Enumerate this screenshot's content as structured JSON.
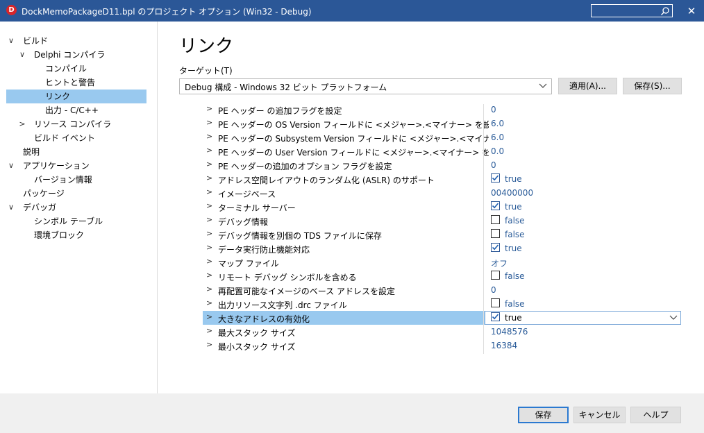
{
  "window": {
    "title": "DockMemoPackageD11.bpl のプロジェクト オプション  (Win32 - Debug)",
    "app_icon": "delphi-icon",
    "search_value": "",
    "close_glyph": "✕"
  },
  "sidebar": {
    "items": [
      {
        "label": "ビルド",
        "arrow": "∨"
      },
      {
        "label": "Delphi コンパイラ",
        "arrow": "∨"
      },
      {
        "label": "コンパイル",
        "arrow": ""
      },
      {
        "label": "ヒントと警告",
        "arrow": ""
      },
      {
        "label": "リンク",
        "arrow": "",
        "selected": true
      },
      {
        "label": "出力 - C/C++",
        "arrow": ""
      },
      {
        "label": "リソース コンパイラ",
        "arrow": ">"
      },
      {
        "label": "ビルド イベント",
        "arrow": ""
      },
      {
        "label": "説明",
        "arrow": ""
      },
      {
        "label": "アプリケーション",
        "arrow": "∨"
      },
      {
        "label": "バージョン情報",
        "arrow": ""
      },
      {
        "label": "パッケージ",
        "arrow": ""
      },
      {
        "label": "デバッガ",
        "arrow": "∨"
      },
      {
        "label": "シンボル テーブル",
        "arrow": ""
      },
      {
        "label": "環境ブロック",
        "arrow": ""
      }
    ]
  },
  "main": {
    "title": "リンク",
    "target_label": "ターゲット(T)",
    "target_value": "Debug 構成 - Windows 32 ビット プラットフォーム",
    "apply_label": "適用(A)...",
    "save_label": "保存(S)..."
  },
  "properties": [
    {
      "name": "PE ヘッダー の追加フラグを設定",
      "value": "0"
    },
    {
      "name": "PE ヘッダーの OS Version フィールドに <メジャー>.<マイナー> を設定",
      "value": "6.0"
    },
    {
      "name": "PE ヘッダーの Subsystem Version フィールドに <メジャー>.<マイナー> を設定",
      "value": "6.0"
    },
    {
      "name": "PE ヘッダーの User Version フィールドに <メジャー>.<マイナー> を設定",
      "value": "0.0"
    },
    {
      "name": "PE ヘッダーの追加のオプション フラグを設定",
      "value": "0"
    },
    {
      "name": "アドレス空間レイアウトのランダム化 (ASLR) のサポート",
      "value": "true",
      "checkbox": true,
      "checked": true
    },
    {
      "name": "イメージベース",
      "value": "00400000"
    },
    {
      "name": "ターミナル サーバー",
      "value": "true",
      "checkbox": true,
      "checked": true
    },
    {
      "name": "デバッグ情報",
      "value": "false",
      "checkbox": true,
      "checked": false
    },
    {
      "name": "デバッグ情報を別個の TDS ファイルに保存",
      "value": "false",
      "checkbox": true,
      "checked": false
    },
    {
      "name": "データ実行防止機能対応",
      "value": "true",
      "checkbox": true,
      "checked": true
    },
    {
      "name": "マップ ファイル",
      "value": "オフ"
    },
    {
      "name": "リモート デバッグ シンボルを含める",
      "value": "false",
      "checkbox": true,
      "checked": false
    },
    {
      "name": "再配置可能なイメージのベース アドレスを設定",
      "value": "0"
    },
    {
      "name": "出力リソース文字列 .drc ファイル",
      "value": "false",
      "checkbox": true,
      "checked": false
    },
    {
      "name": "大きなアドレスの有効化",
      "value": "true",
      "checkbox": true,
      "checked": true,
      "selected": true
    },
    {
      "name": "最大スタック サイズ",
      "value": "1048576"
    },
    {
      "name": "最小スタック サイズ",
      "value": "16384"
    }
  ],
  "footer": {
    "save_label": "保存",
    "cancel_label": "キャンセル",
    "help_label": "ヘルプ"
  },
  "colors": {
    "titlebar": "#2b5797",
    "selection": "#99c9ef",
    "value_text": "#2b5c99"
  }
}
